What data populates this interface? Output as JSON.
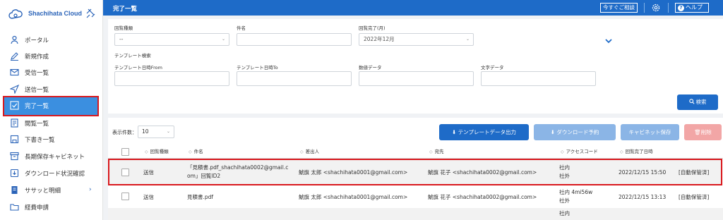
{
  "sidebar": {
    "brand": "Shachihata Cloud",
    "items": [
      {
        "label": "ポータル",
        "icon": "person-icon"
      },
      {
        "label": "新規作成",
        "icon": "pencil-icon"
      },
      {
        "label": "受信一覧",
        "icon": "mail-icon"
      },
      {
        "label": "送信一覧",
        "icon": "send-icon"
      },
      {
        "label": "完了一覧",
        "icon": "check-square-icon",
        "active": true
      },
      {
        "label": "閲覧一覧",
        "icon": "document-icon"
      },
      {
        "label": "下書き一覧",
        "icon": "save-icon"
      },
      {
        "label": "長期保存キャビネット",
        "icon": "archive-icon"
      },
      {
        "label": "ダウンロード状況確認",
        "icon": "download-icon"
      },
      {
        "label": "ササッと明細",
        "icon": "receipt-icon",
        "chevron": "›"
      },
      {
        "label": "経費申請",
        "icon": "folder-icon"
      }
    ]
  },
  "header": {
    "title": "完了一覧",
    "consult_label": "今すぐご相談",
    "help_label": "ヘルプ"
  },
  "search": {
    "doc_type_label": "回覧種類",
    "doc_type_value": "--",
    "subject_label": "件名",
    "subject_value": "",
    "completed_month_label": "回覧完了(月)",
    "completed_month_value": "2022年12月",
    "template_search_label": "テンプレート検索",
    "template_date_from_label": "テンプレート日時From",
    "template_date_to_label": "テンプレート日時To",
    "numeric_label": "数値データ",
    "text_label": "文字データ",
    "search_button": "検索"
  },
  "results": {
    "count_label": "表示件数：",
    "count_value": "10",
    "buttons": {
      "template_export": "テンプレートデータ出力",
      "download_reserve": "ダウンロード予約",
      "cabinet_save": "キャビネット保存",
      "delete": "削除"
    },
    "columns": [
      "回覧種類",
      "件名",
      "差出人",
      "宛先",
      "アクセスコード",
      "回覧完了日時"
    ],
    "rows": [
      {
        "type": "送信",
        "subject_line1": "「見積書.pdf_shachihata0002@gmail.c",
        "subject_line2": "om」回覧ID2",
        "sender": "鯱旗 太郎 <shachihata0001@gmail.com>",
        "recipient": "鯱旗 花子 <shachihata0002@gmail.com>",
        "access_line1": "社内",
        "access_line2": "社外",
        "completed": "2022/12/15 15:50",
        "status": "[自動保管済]"
      },
      {
        "type": "送信",
        "subject_line1": "見積書.pdf",
        "subject_line2": "",
        "sender": "鯱旗 太郎 <shachihata0001@gmail.com>",
        "recipient": "鯱旗 花子 <shachihata0002@gmail.com>",
        "access_line1": "社内 4mi56w",
        "access_line2": "社外",
        "completed": "2022/12/15 13:13",
        "status": "[自動保管済]"
      },
      {
        "type": "",
        "subject_line1": "",
        "subject_line2": "",
        "sender": "",
        "recipient": "",
        "access_line1": "社内",
        "access_line2": "",
        "completed": "",
        "status": ""
      }
    ]
  },
  "colors": {
    "primary": "#1e6bc8",
    "active": "#3b8fe0",
    "highlight": "#d9191e"
  }
}
